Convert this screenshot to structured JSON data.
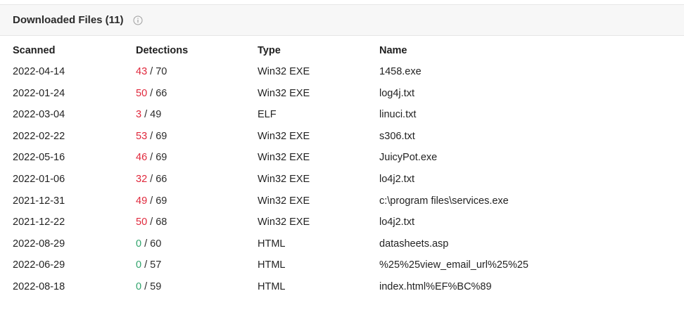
{
  "panel": {
    "title": "Downloaded Files (11)",
    "info_icon": "info-circle-icon"
  },
  "columns": {
    "scanned": "Scanned",
    "detections": "Detections",
    "type": "Type",
    "name": "Name"
  },
  "rows": [
    {
      "scanned": "2022-04-14",
      "positives": "43",
      "total": "/ 70",
      "type": "Win32 EXE",
      "name": "1458.exe"
    },
    {
      "scanned": "2022-01-24",
      "positives": "50",
      "total": "/ 66",
      "type": "Win32 EXE",
      "name": "log4j.txt"
    },
    {
      "scanned": "2022-03-04",
      "positives": "3",
      "total": "/ 49",
      "type": "ELF",
      "name": "linuci.txt"
    },
    {
      "scanned": "2022-02-22",
      "positives": "53",
      "total": "/ 69",
      "type": "Win32 EXE",
      "name": "s306.txt"
    },
    {
      "scanned": "2022-05-16",
      "positives": "46",
      "total": "/ 69",
      "type": "Win32 EXE",
      "name": "JuicyPot.exe"
    },
    {
      "scanned": "2022-01-06",
      "positives": "32",
      "total": "/ 66",
      "type": "Win32 EXE",
      "name": "lo4j2.txt"
    },
    {
      "scanned": "2021-12-31",
      "positives": "49",
      "total": "/ 69",
      "type": "Win32 EXE",
      "name": "c:\\program files\\services.exe"
    },
    {
      "scanned": "2021-12-22",
      "positives": "50",
      "total": "/ 68",
      "type": "Win32 EXE",
      "name": "lo4j2.txt"
    },
    {
      "scanned": "2022-08-29",
      "positives": "0",
      "total": "/ 60",
      "type": "HTML",
      "name": "datasheets.asp"
    },
    {
      "scanned": "2022-06-29",
      "positives": "0",
      "total": "/ 57",
      "type": "HTML",
      "name": "%25%25view_email_url%25%25"
    },
    {
      "scanned": "2022-08-18",
      "positives": "0",
      "total": "/ 59",
      "type": "HTML",
      "name": "index.html%EF%BC%89"
    }
  ],
  "colors": {
    "malicious": "#e0283c",
    "clean": "#2fa36b",
    "header_bg": "#f7f7f7"
  }
}
